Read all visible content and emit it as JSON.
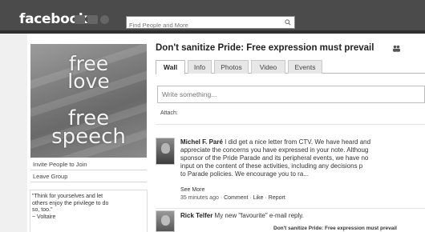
{
  "topbar": {
    "logo": "facebook",
    "search_placeholder": "Find People and More",
    "icons": [
      "friend-requests-icon",
      "messages-icon",
      "notifications-icon"
    ]
  },
  "sidebar": {
    "profile_image_text": [
      "free",
      "love",
      "free",
      "speech"
    ],
    "links": [
      "Invite People to Join",
      "Leave Group"
    ],
    "quote_lines": [
      "\"Think for yourselves and let",
      "others enjoy the privilege to do",
      "so, too.\"",
      "~ Voltaire"
    ]
  },
  "main": {
    "title": "Don't sanitize Pride: Free expression must prevail",
    "tabs": [
      {
        "label": "Wall",
        "active": true
      },
      {
        "label": "Info",
        "active": false
      },
      {
        "label": "Photos",
        "active": false
      },
      {
        "label": "Video",
        "active": false
      },
      {
        "label": "Events",
        "active": false
      }
    ],
    "composer_placeholder": "Write something...",
    "attach_label": "Attach:",
    "posts": [
      {
        "author": "Michel F. Paré",
        "lines": [
          "I did get a nice letter from CTV. We have heard and",
          "appreciate the concerns you have expressed in your note. Althoug",
          "sponsor of the Pride Parade and its peripheral events, we have no",
          "input on the content of these activities, including any decisions p",
          "to Parade policies. We encourage you to ra..."
        ],
        "see_more": "See More",
        "time": "35 minutes ago",
        "actions": [
          "Comment",
          "Like",
          "Report"
        ]
      },
      {
        "author": "Rick Telfer",
        "text": "My new \"favourite\" e-mail reply.",
        "shared_title": "Don't sanitize Pride: Free expression must prevail"
      }
    ]
  }
}
